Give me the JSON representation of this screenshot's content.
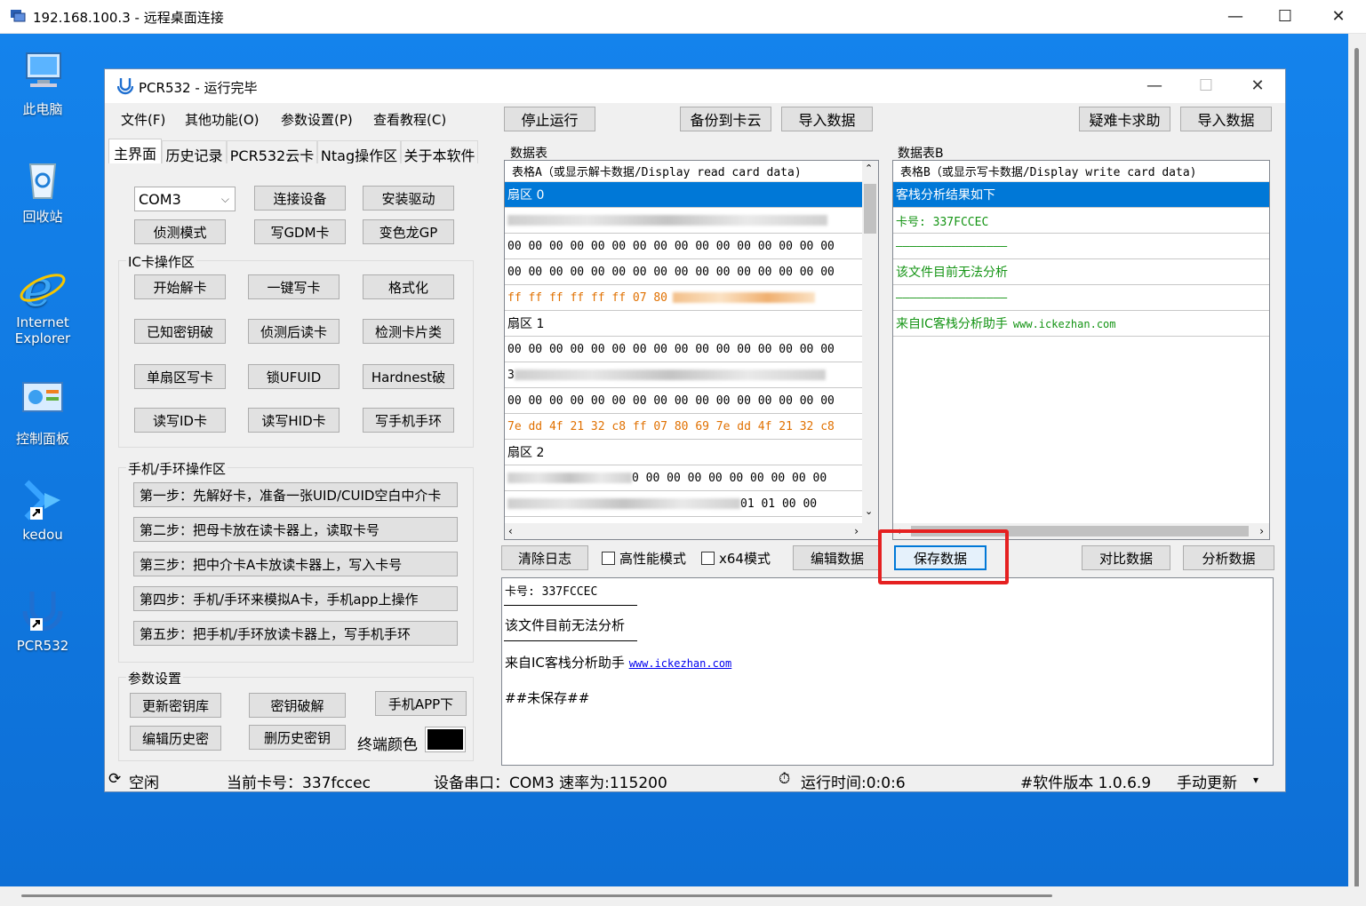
{
  "rdp": {
    "title": "192.168.100.3 - 远程桌面连接",
    "minimize": "—",
    "maximize": "☐",
    "close": "✕"
  },
  "desktop_icons": [
    {
      "label": "此电脑"
    },
    {
      "label": "回收站"
    },
    {
      "label_line1": "Internet",
      "label_line2": "Explorer"
    },
    {
      "label": "控制面板"
    },
    {
      "label": "kedou"
    },
    {
      "label": "PCR532"
    }
  ],
  "app": {
    "title": "PCR532 - 运行完毕",
    "minimize": "—",
    "maximize": "☐",
    "close": "✕",
    "menu": [
      "文件(F)",
      "其他功能(O)",
      "参数设置(P)",
      "查看教程(C)"
    ],
    "toolbar": {
      "stop": "停止运行",
      "backup_cloud": "备份到卡云",
      "import_a": "导入数据",
      "help": "疑难卡求助",
      "import_b": "导入数据"
    },
    "tabs": [
      "主界面",
      "历史记录",
      "PCR532云卡",
      "Ntag操作区",
      "关于本软件"
    ],
    "device": {
      "port": "COM3",
      "connect": "连接设备",
      "install_driver": "安装驱动",
      "detect_mode": "侦测模式",
      "write_gdm": "写GDM卡",
      "chameleon_gp": "变色龙GP"
    },
    "ic_group": {
      "title": "IC卡操作区",
      "buttons": [
        "开始解卡",
        "一键写卡",
        "格式化",
        "已知密钥破",
        "侦测后读卡",
        "检测卡片类",
        "单扇区写卡",
        "锁UFUID",
        "Hardnest破",
        "读写ID卡",
        "读写HID卡",
        "写手机手环"
      ]
    },
    "phone_group": {
      "title": "手机/手环操作区",
      "steps": [
        "第一步：先解好卡，准备一张UID/CUID空白中介卡",
        "第二步：把母卡放在读卡器上，读取卡号",
        "第三步：把中介卡A卡放读卡器上，写入卡号",
        "第四步：手机/手环来模拟A卡，手机app上操作",
        "第五步：把手机/手环放读卡器上，写手机手环"
      ]
    },
    "param_group": {
      "title": "参数设置",
      "update_keys": "更新密钥库",
      "key_crack": "密钥破解",
      "phone_app": "手机APP下",
      "edit_history": "编辑历史密",
      "delete_history": "删历史密钥",
      "terminal_color_label": "终端颜色",
      "terminal_color": "#000000"
    },
    "table_a": {
      "label": "数据表",
      "header": "表格A（或显示解卡数据/Display read card data)",
      "rows": [
        {
          "text": "扇区 0",
          "style": "sel sector"
        },
        {
          "text": "",
          "style": "blurred"
        },
        {
          "text": "00 00 00 00 00 00 00 00 00 00 00 00 00 00 00 00",
          "style": ""
        },
        {
          "text": "00 00 00 00 00 00 00 00 00 00 00 00 00 00 00 00",
          "style": ""
        },
        {
          "text": "ff ff ff ff ff ff 07 80",
          "style": "orange"
        },
        {
          "text": "扇区 1",
          "style": "sector"
        },
        {
          "text": "00 00 00 00 00 00 00 00 00 00 00 00 00 00 00 00",
          "style": ""
        },
        {
          "text": "3",
          "style": "blurred-lead"
        },
        {
          "text": "00 00 00 00 00 00 00 00 00 00 00 00 00 00 00 00",
          "style": ""
        },
        {
          "text": "7e dd 4f 21 32 c8 ff 07 80 69 7e dd 4f 21 32 c8",
          "style": "orange"
        },
        {
          "text": "扇区 2",
          "style": "sector"
        },
        {
          "text": "0 00 00 00 00 00 00 00 00 00",
          "style": "blurred-tail"
        },
        {
          "text": "01 01 00 00",
          "style": "blurred-tail2"
        }
      ]
    },
    "table_b": {
      "label": "数据表B",
      "header": "表格B（或显示写卡数据/Display write card data)",
      "rows": [
        {
          "text": "客栈分析结果如下",
          "style": "sel sector"
        },
        {
          "text": "卡号: 337FCCEC",
          "style": "green"
        },
        {
          "text": "————————————————",
          "style": "green"
        },
        {
          "text": "该文件目前无法分析",
          "style": "green sector"
        },
        {
          "text": "————————————————",
          "style": "green"
        },
        {
          "text_prefix": "来自IC客栈分析助手",
          "text_url": "www.ickezhan.com",
          "style": "green"
        }
      ]
    },
    "actions": {
      "clear_log": "清除日志",
      "high_perf": "高性能模式",
      "x64": "x64模式",
      "edit_data": "编辑数据",
      "save_data": "保存数据",
      "compare_data": "对比数据",
      "analyze_data": "分析数据"
    },
    "log": {
      "card_no": "卡号: 337FCCEC",
      "cannot_analyze": "该文件目前无法分析",
      "source_prefix": "来自IC客栈分析助手",
      "source_url": "www.ickezhan.com",
      "unsaved": "##未保存##"
    },
    "status": {
      "idle": "空闲",
      "card": "当前卡号：337fccec",
      "port": "设备串口：COM3 速率为:115200",
      "runtime": "运行时间:0:0:6",
      "version": "#软件版本 1.0.6.9",
      "update": "手动更新"
    }
  },
  "colors": {
    "desktop": "#1483ec",
    "selection": "#0078d7",
    "highlight": "#e52020",
    "green_text": "#149414",
    "orange_text": "#e07000"
  }
}
